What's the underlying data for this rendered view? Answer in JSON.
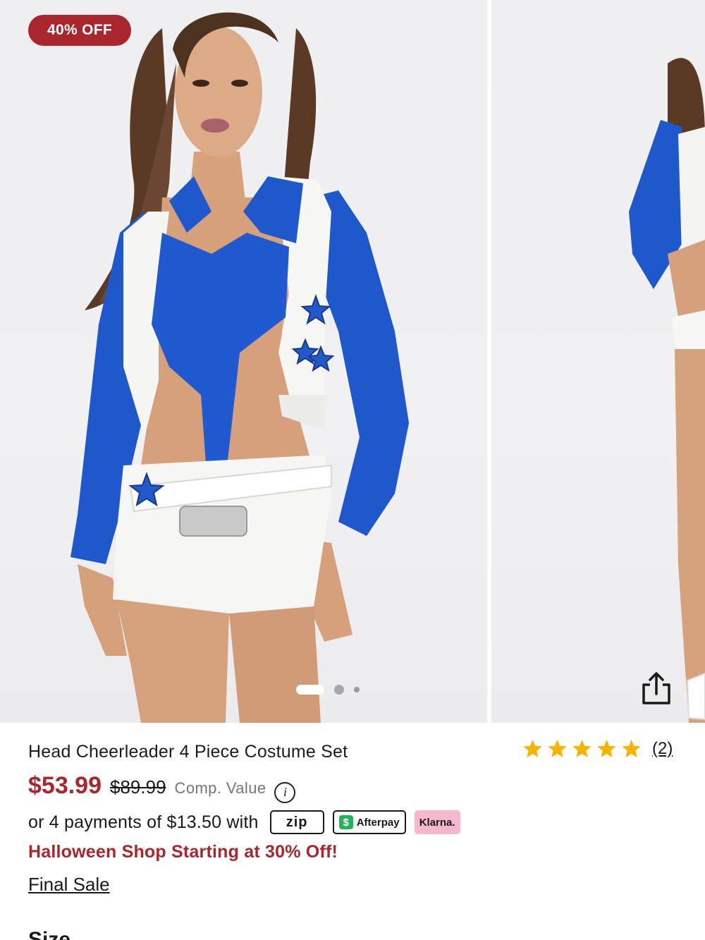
{
  "badge": {
    "label": "40% OFF",
    "color": "#a8262d"
  },
  "carousel": {
    "slide_count": 3,
    "active_index": 0,
    "images": [
      "product-photo-front",
      "product-photo-side"
    ]
  },
  "share": {
    "icon": "share-icon"
  },
  "product": {
    "title": "Head Cheerleader 4 Piece Costume Set",
    "rating": {
      "stars": 5,
      "max": 5,
      "review_count": "(2)",
      "star_color": "#f5b400"
    },
    "price": {
      "sale": "$53.99",
      "original": "$89.99",
      "comp_label": "Comp. Value",
      "info_glyph": "i",
      "sale_color": "#a8262d"
    },
    "payments": {
      "text": "or 4 payments of $13.50 with",
      "providers": {
        "zip": "zip",
        "afterpay": "Afterpay",
        "afterpay_glyph": "$",
        "klarna": "Klarna."
      }
    },
    "promo": "Halloween Shop Starting at 30% Off!",
    "final_sale": "Final Sale",
    "size_label": "Size"
  }
}
